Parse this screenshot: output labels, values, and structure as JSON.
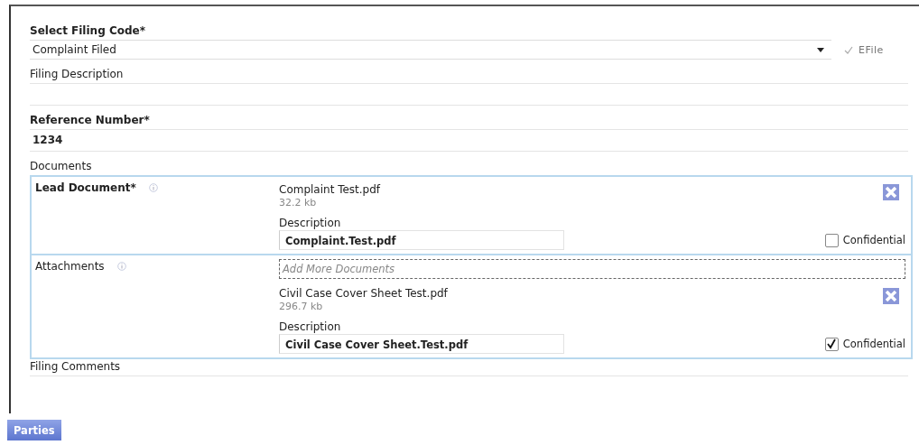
{
  "filing_code": {
    "label": "Select Filing Code*",
    "value": "Complaint Filed",
    "efile": {
      "label": "EFile",
      "checked": true
    }
  },
  "filing_description": {
    "label": "Filing Description"
  },
  "reference_number": {
    "label": "Reference Number*",
    "value": "1234"
  },
  "documents": {
    "label": "Documents",
    "sections": [
      {
        "kind": "lead",
        "label": "Lead Document*",
        "files": [
          {
            "name": "Complaint Test.pdf",
            "size": "32.2 kb",
            "description_label": "Description",
            "description": "Complaint.Test.pdf",
            "confidential_label": "Confidential",
            "confidential": false
          }
        ]
      },
      {
        "kind": "attachments",
        "label": "Attachments",
        "add_placeholder": "Add More Documents",
        "files": [
          {
            "name": "Civil Case Cover Sheet Test.pdf",
            "size": "296.7 kb",
            "description_label": "Description",
            "description": "Civil Case Cover Sheet.Test.pdf",
            "confidential_label": "Confidential",
            "confidential": true
          }
        ]
      }
    ]
  },
  "filing_comments": {
    "label": "Filing Comments"
  },
  "parties_button": "Parties"
}
